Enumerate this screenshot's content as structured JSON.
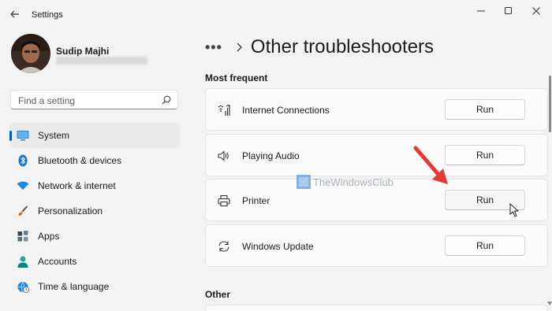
{
  "window": {
    "title": "Settings",
    "controls": [
      "minimize",
      "maximize",
      "close"
    ]
  },
  "user": {
    "name": "Sudip Majhi"
  },
  "search": {
    "placeholder": "Find a setting"
  },
  "nav": {
    "items": [
      {
        "label": "System",
        "icon": "monitor-icon",
        "active": true
      },
      {
        "label": "Bluetooth & devices",
        "icon": "bluetooth-icon"
      },
      {
        "label": "Network & internet",
        "icon": "wifi-icon"
      },
      {
        "label": "Personalization",
        "icon": "brush-icon"
      },
      {
        "label": "Apps",
        "icon": "apps-icon"
      },
      {
        "label": "Accounts",
        "icon": "person-icon"
      },
      {
        "label": "Time & language",
        "icon": "globe-clock-icon"
      }
    ]
  },
  "header": {
    "more": "•••",
    "title": "Other troubleshooters"
  },
  "sections": {
    "most_frequent": "Most frequent",
    "other": "Other"
  },
  "troubleshooters": [
    {
      "label": "Internet Connections",
      "icon": "signal-icon",
      "button": "Run"
    },
    {
      "label": "Playing Audio",
      "icon": "speaker-icon",
      "button": "Run"
    },
    {
      "label": "Printer",
      "icon": "printer-icon",
      "button": "Run"
    },
    {
      "label": "Windows Update",
      "icon": "sync-icon",
      "button": "Run"
    }
  ],
  "watermark": {
    "text": "TheWindowsClub"
  },
  "colors": {
    "accent": "#005fb8",
    "annotation_arrow": "#e53935"
  }
}
